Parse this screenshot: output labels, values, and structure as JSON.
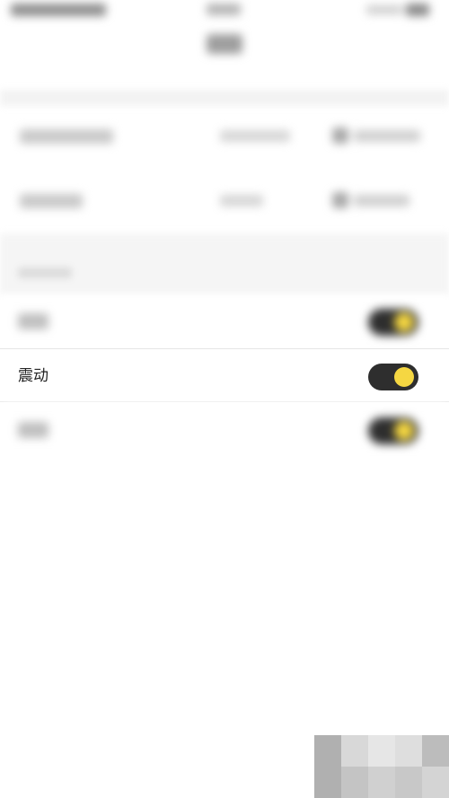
{
  "settings": {
    "vibration_label": "震动",
    "vibration_on": true
  },
  "colors": {
    "toggle_track": "#2e2e2e",
    "toggle_knob": "#f5d742"
  }
}
